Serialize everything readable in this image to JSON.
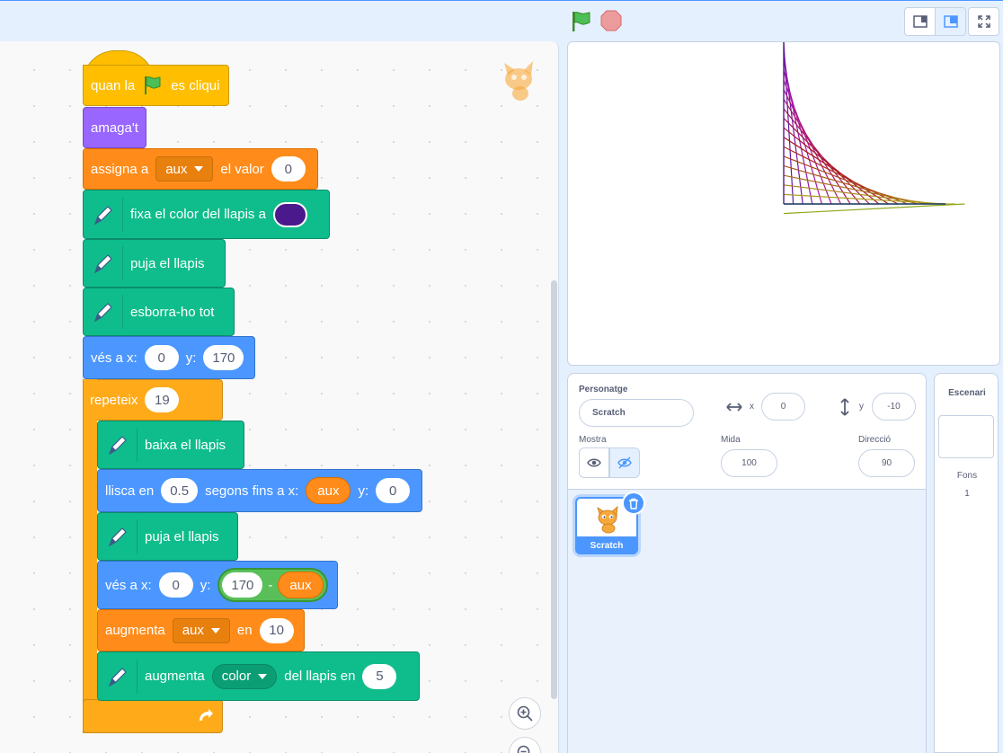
{
  "toolbar": {
    "green_flag": "green-flag-icon",
    "stop": "stop-icon",
    "small_stage": "small-stage-icon",
    "normal_stage": "normal-stage-icon",
    "fullscreen": "fullscreen-icon"
  },
  "colors": {
    "events": "#ffbf00",
    "looks": "#9966ff",
    "variables": "#ff8c1a",
    "pen": "#0fbd8c",
    "motion": "#4c97ff",
    "control": "#ffab19",
    "operators": "#59c059",
    "pen_color": "#4a1a8c"
  },
  "script": {
    "hat": {
      "before": "quan la",
      "after": "es cliqui"
    },
    "hide": "amaga't",
    "set_var": {
      "label": "assigna a",
      "var": "aux",
      "mid": "el valor",
      "value": "0"
    },
    "set_pen_color": {
      "label": "fixa el color del llapis a"
    },
    "pen_up_1": "puja el llapis",
    "erase_all": "esborra-ho tot",
    "goto_1": {
      "label_x": "vés a x:",
      "x": "0",
      "label_y": "y:",
      "y": "170"
    },
    "repeat": {
      "label": "repeteix",
      "count": "19"
    },
    "pen_down": "baixa el llapis",
    "glide": {
      "label": "llisca en",
      "secs": "0.5",
      "mid": "segons fins a x:",
      "x_reporter": "aux",
      "label_y": "y:",
      "y": "0"
    },
    "pen_up_2": "puja el llapis",
    "goto_2": {
      "label_x": "vés a x:",
      "x": "0",
      "label_y": "y:",
      "op_left": "170",
      "op_symbol": "-",
      "op_right": "aux"
    },
    "change_var": {
      "label": "augmenta",
      "var": "aux",
      "mid": "en",
      "value": "10"
    },
    "change_pen": {
      "label": "augmenta",
      "param": "color",
      "mid": "del llapis en",
      "value": "5"
    }
  },
  "sprite_panel": {
    "sprite_label": "Personatge",
    "sprite_name": "Scratch",
    "x_label": "x",
    "x_value": "0",
    "y_label": "y",
    "y_value": "-10",
    "show_label": "Mostra",
    "size_label": "Mida",
    "size_value": "100",
    "direction_label": "Direcció",
    "direction_value": "90"
  },
  "sprite_list": [
    {
      "name": "Scratch",
      "selected": true
    }
  ],
  "stage_pane": {
    "title": "Escenari",
    "backdrops_label": "Fons",
    "backdrops_count": "1"
  }
}
